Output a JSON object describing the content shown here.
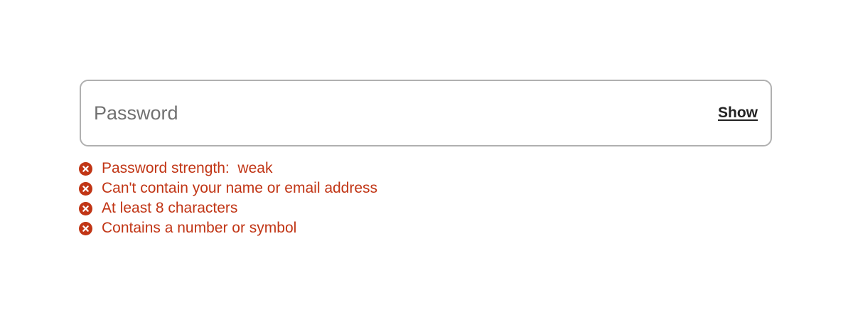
{
  "password_field": {
    "placeholder": "Password",
    "value": "",
    "show_label": "Show"
  },
  "requirements": [
    {
      "icon": "error-x-icon",
      "label": "Password strength:  weak"
    },
    {
      "icon": "error-x-icon",
      "label": "Can't contain your name or email address"
    },
    {
      "icon": "error-x-icon",
      "label": "At least 8 characters"
    },
    {
      "icon": "error-x-icon",
      "label": "Contains a number or symbol"
    }
  ],
  "colors": {
    "error": "#c13515",
    "border": "#b0b0b0",
    "placeholder": "#717171",
    "text": "#222222"
  }
}
